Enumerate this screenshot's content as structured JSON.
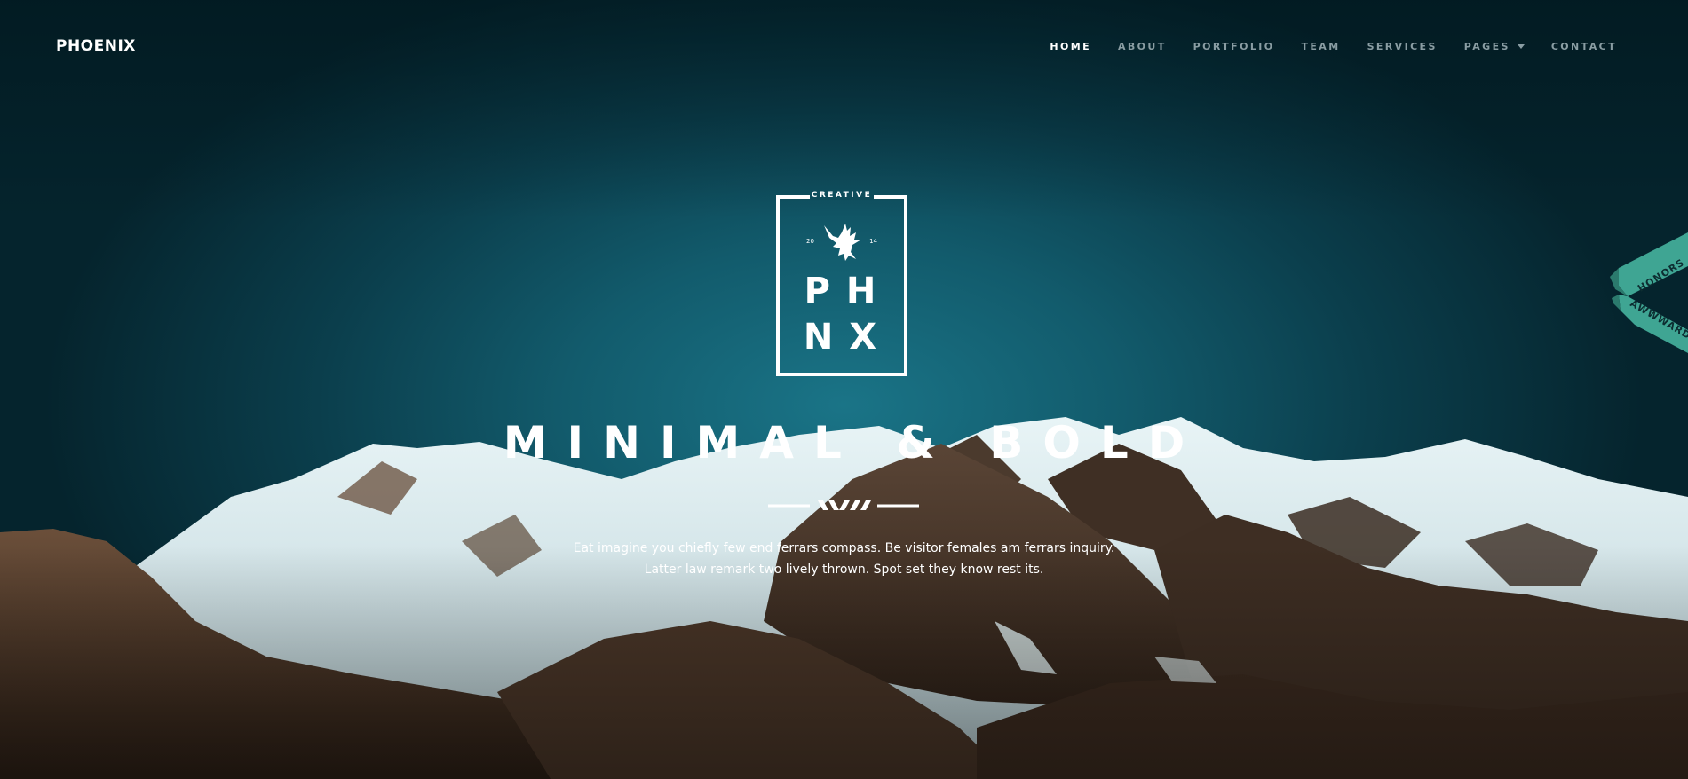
{
  "header": {
    "brand": "PHOENIX"
  },
  "nav": {
    "items": [
      {
        "label": "HOME",
        "active": true
      },
      {
        "label": "ABOUT",
        "active": false
      },
      {
        "label": "PORTFOLIO",
        "active": false
      },
      {
        "label": "TEAM",
        "active": false
      },
      {
        "label": "SERVICES",
        "active": false
      },
      {
        "label": "PAGES",
        "active": false,
        "has_dropdown": true
      },
      {
        "label": "CONTACT",
        "active": false
      }
    ]
  },
  "badge": {
    "top_label": "CREATIVE",
    "year_left": "20",
    "year_right": "14",
    "row1": "PH",
    "row2": "NX",
    "icon": "eagle-icon"
  },
  "hero": {
    "headline": "MINIMAL & BOLD",
    "tagline_line1": "Eat imagine you chiefly few end ferrars compass. Be visitor females am ferrars inquiry.",
    "tagline_line2": "Latter law remark two lively thrown. Spot set they know rest its."
  },
  "ribbon": {
    "line1": "HONORS",
    "line2": "AWWWARDS"
  },
  "colors": {
    "sky_center": "#1a7487",
    "sky_edge": "#05242d",
    "nav_inactive": "#8a9da3",
    "ribbon": "#3fa593"
  }
}
